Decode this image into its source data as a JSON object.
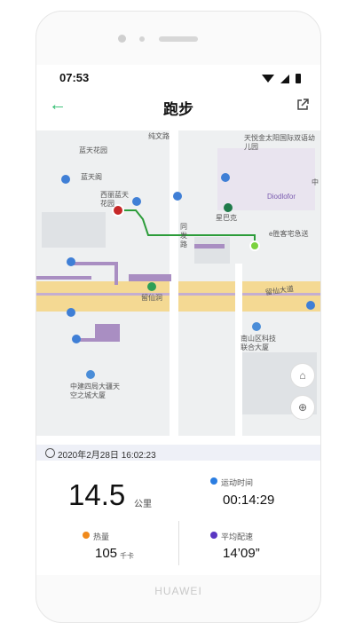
{
  "status_bar": {
    "time": "07:53"
  },
  "app_bar": {
    "title": "跑步",
    "back_icon": "back-arrow-icon",
    "share_icon": "share-icon"
  },
  "map": {
    "labels": {
      "top_road": "纯文路",
      "tianyue": "天悦金太阳国际双语幼儿园",
      "lantian_garden": "蓝天花园",
      "lantian_ge": "蓝天阁",
      "xili_lantian": "西丽蓝天花园",
      "zhong": "中",
      "diodlofor": "Diodlofor",
      "starbucks": "星巴克",
      "delivery": "e胜客宅急送",
      "tongfa_road": "同发路",
      "liuxian_road": "留仙大道",
      "liuxian_dong": "留仙洞",
      "nanshan_tech": "南山区科技联合大厦",
      "zhongjian": "中建四局大疆天空之城大厦"
    }
  },
  "info": {
    "date": "2020年2月28日 16:02:23",
    "distance": "14.5",
    "distance_unit": "公里",
    "duration_label": "运动时间",
    "duration": "00:14:29",
    "calories_label": "热量",
    "calories": "105",
    "calories_unit": "千卡",
    "pace_label": "平均配速",
    "pace": "14’09”"
  },
  "brand": "HUAWEI"
}
